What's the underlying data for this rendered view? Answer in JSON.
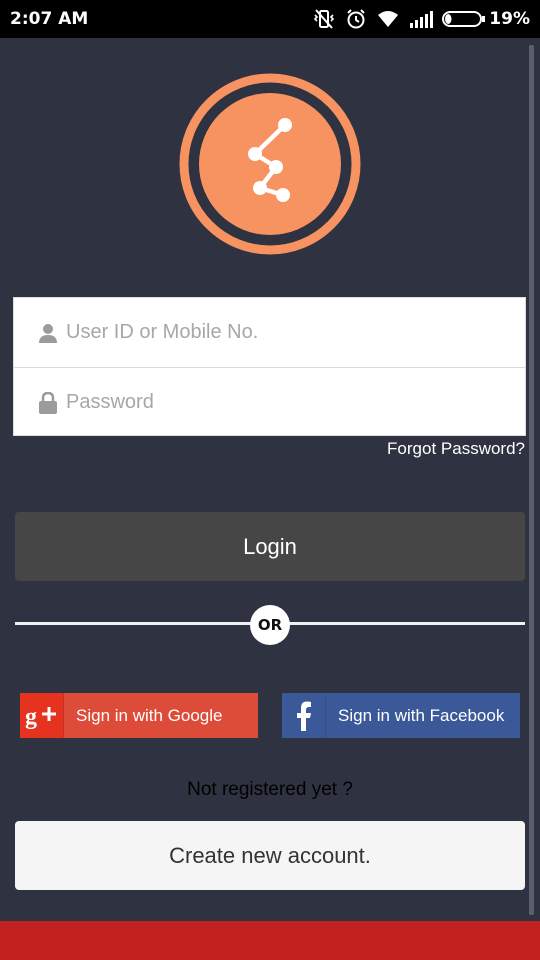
{
  "status_bar": {
    "time": "2:07 AM",
    "battery_percent": "19%",
    "battery_level": 0.19,
    "icons": [
      "vibrate-off-icon",
      "alarm-icon",
      "wifi-icon",
      "signal-icon",
      "battery-icon"
    ]
  },
  "logo": {
    "icon": "share-network-icon",
    "color": "#f79360"
  },
  "login_form": {
    "user_placeholder": "User ID or Mobile No.",
    "user_value": "",
    "password_placeholder": "Password",
    "password_value": "",
    "forgot_password": "Forgot Password?"
  },
  "login_button": "Login",
  "or_divider": "OR",
  "social": {
    "google_label": "Sign in with Google",
    "google_color": "#dd4b39",
    "facebook_label": "Sign in with Facebook",
    "facebook_color": "#3b5998"
  },
  "not_registered": "Not registered yet ?",
  "create_account": "Create new account.",
  "colors": {
    "background": "#2f3240",
    "bottom_bar": "#c32020",
    "login_button": "#464646"
  }
}
